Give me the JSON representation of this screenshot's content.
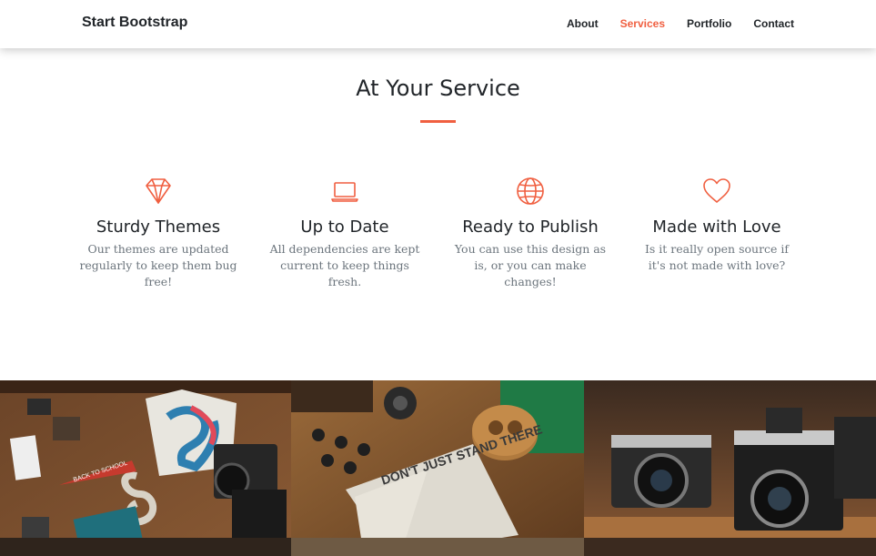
{
  "navbar": {
    "brand": "Start Bootstrap",
    "links": [
      {
        "label": "About",
        "active": false
      },
      {
        "label": "Services",
        "active": true
      },
      {
        "label": "Portfolio",
        "active": false
      },
      {
        "label": "Contact",
        "active": false
      }
    ]
  },
  "services": {
    "title": "At Your Service",
    "accent_color": "#f05f40",
    "items": [
      {
        "icon": "diamond-icon",
        "heading": "Sturdy Themes",
        "text": "Our themes are updated regularly to keep them bug free!"
      },
      {
        "icon": "laptop-icon",
        "heading": "Up to Date",
        "text": "All dependencies are kept current to keep things fresh."
      },
      {
        "icon": "globe-icon",
        "heading": "Ready to Publish",
        "text": "You can use this design as is, or you can make changes!"
      },
      {
        "icon": "heart-icon",
        "heading": "Made with Love",
        "text": "Is it really open source if it's not made with love?"
      }
    ]
  },
  "portfolio": {
    "tiles": [
      {
        "description": "flat-lay of printed merchandise on a wooden table",
        "sign_text": "BACK TO SCHOOL"
      },
      {
        "description": "notebook with lettering on a wooden desk",
        "sign_text": "DON'T JUST STAND THERE"
      },
      {
        "description": "vintage cameras on a wooden shelf",
        "sign_text": ""
      }
    ]
  }
}
